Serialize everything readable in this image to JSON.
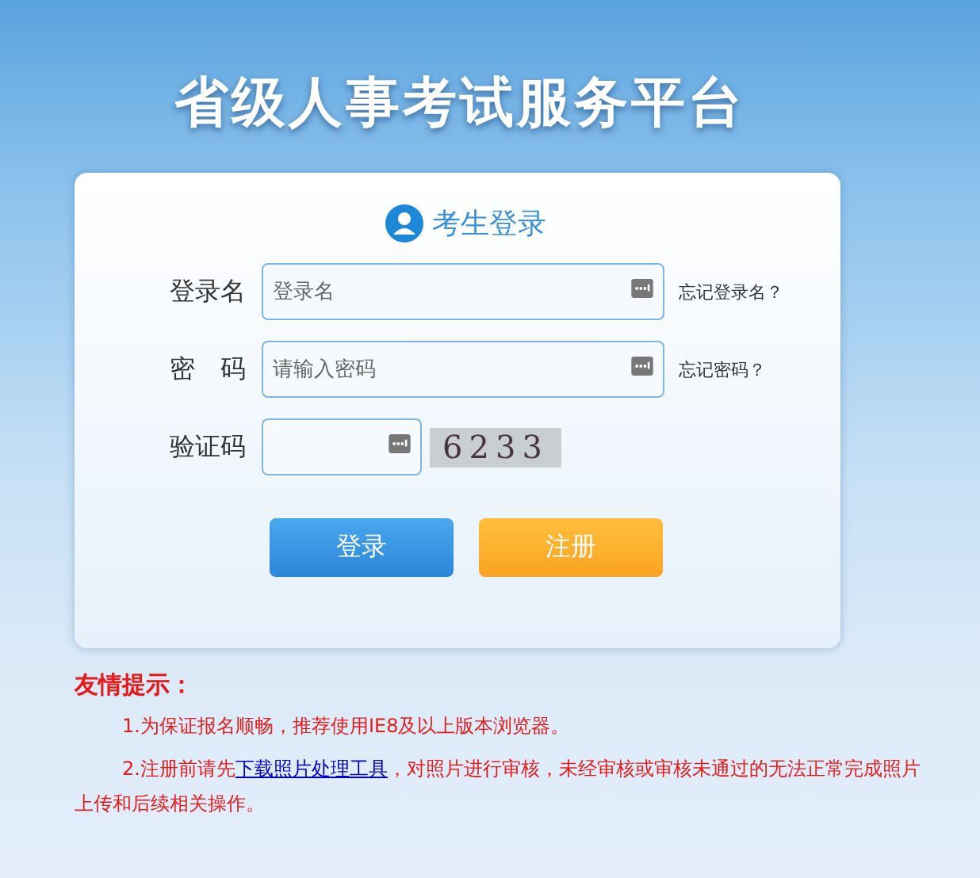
{
  "site_title": "省级人事考试服务平台",
  "login": {
    "heading": "考生登录",
    "fields": [
      {
        "label": "登录名",
        "kind": "text",
        "placeholder": "登录名",
        "help_link": "忘记登录名？"
      },
      {
        "label": "密　码",
        "kind": "password",
        "placeholder": "请输入密码",
        "help_link": "忘记密码？"
      },
      {
        "label": "验证码",
        "kind": "captcha",
        "captcha": "6233"
      }
    ],
    "buttons": [
      {
        "label": "登录",
        "kind": "primary"
      },
      {
        "label": "注册",
        "kind": "secondary"
      }
    ]
  },
  "tips": {
    "title": "友情提示：",
    "items": [
      {
        "before": "1.为保证报名顺畅，推荐使用IE8及以上版本浏览器。"
      },
      {
        "before": "2.注册前请先",
        "link": "下载照片处理工具",
        "after": "，对照片进行审核，未经审核或审核未通过的无法正常完成照片上传和后续相关操作。"
      }
    ]
  }
}
